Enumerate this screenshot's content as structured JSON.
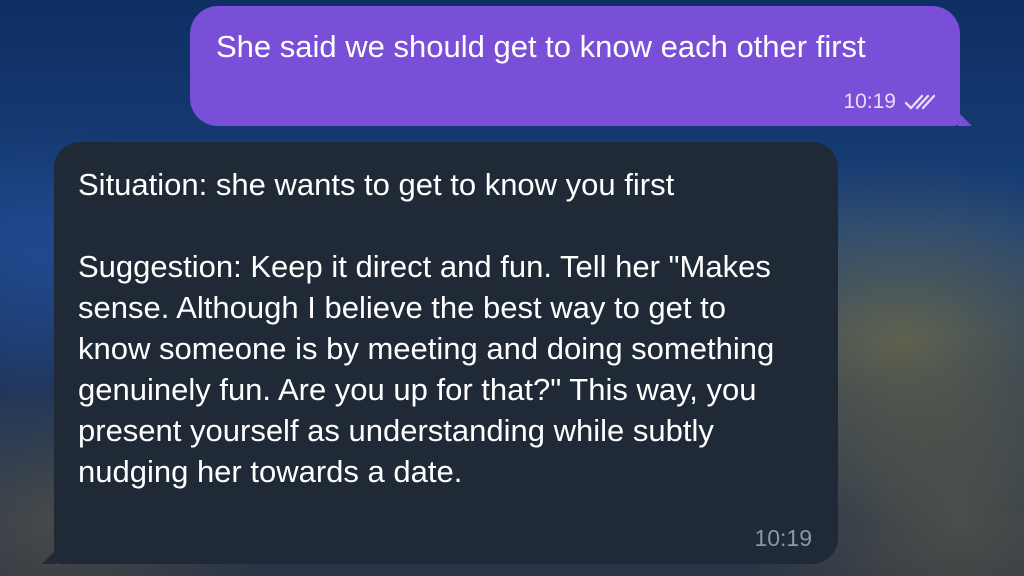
{
  "messages": {
    "outgoing": {
      "text": "She said we should get to know each other first",
      "time": "10:19",
      "status_icon": "double-check-icon",
      "bubble_color": "#7a4fd8"
    },
    "incoming": {
      "situation": "Situation: she wants to get to know you first",
      "suggestion": "Suggestion: Keep it direct and fun. Tell her \"Makes sense. Although I believe the best way to get to know someone is by meeting and doing something genuinely fun. Are you up for that?\" This way, you present yourself as understanding while subtly nudging her towards a date.",
      "time": "10:19",
      "bubble_color": "#1f2a36"
    }
  }
}
